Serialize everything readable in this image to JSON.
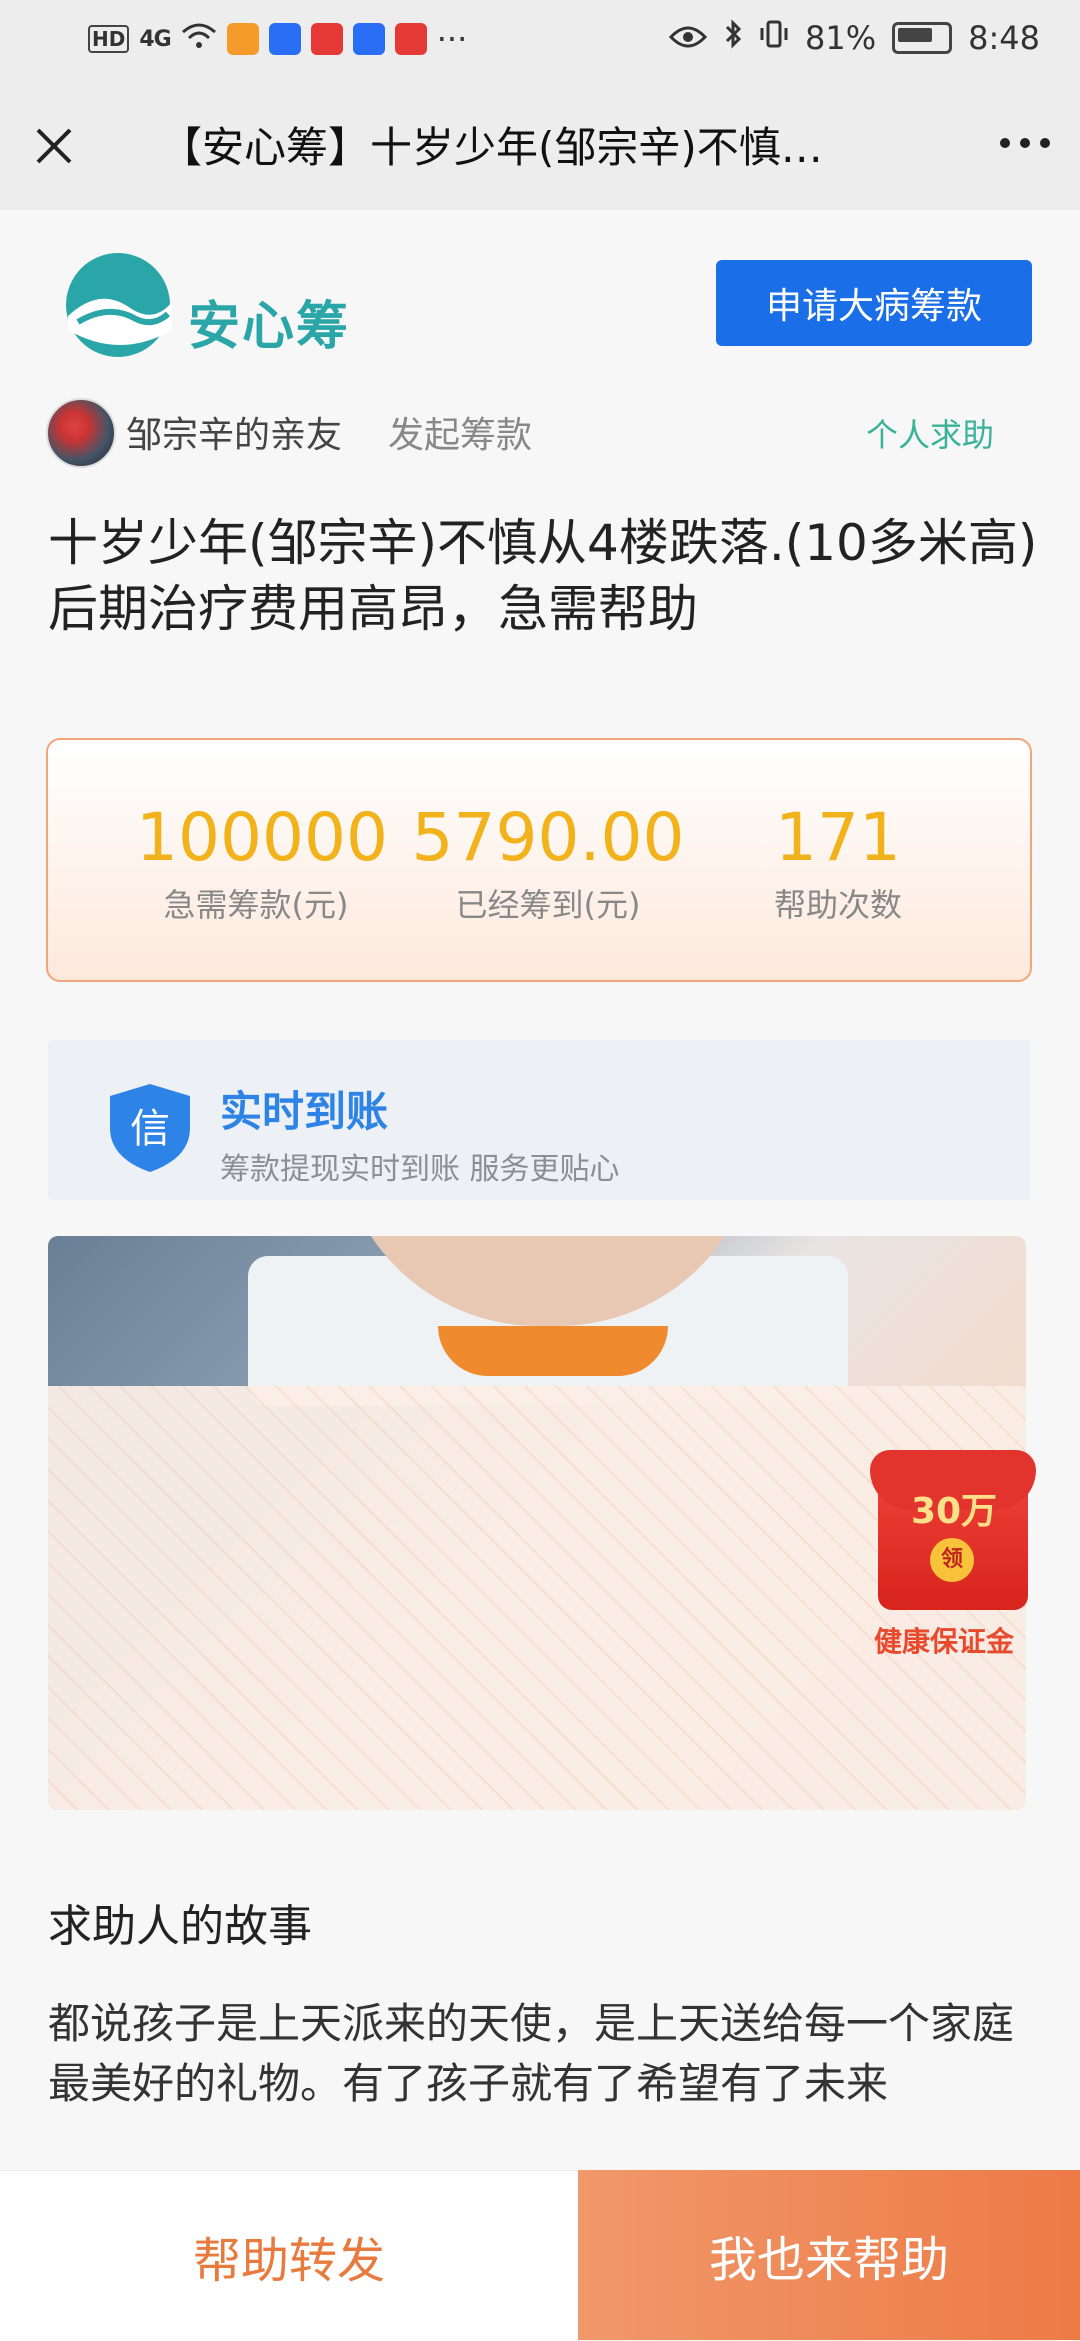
{
  "status_bar": {
    "network": "4G",
    "battery": "81%",
    "time": "8:48",
    "more": "···"
  },
  "nav": {
    "title": "【安心筹】十岁少年(邹宗辛)不慎…"
  },
  "brand": {
    "name": "安心筹",
    "apply_button": "申请大病筹款"
  },
  "organizer": {
    "name": "邹宗辛的亲友",
    "action": "发起筹款",
    "type": "个人求助"
  },
  "headline": "十岁少年(邹宗辛)不慎从4楼跌落.(10多米高)后期治疗费用高昂，急需帮助",
  "stats": [
    {
      "value": "100000",
      "label": "急需筹款(元)"
    },
    {
      "value": "5790.00",
      "label": "已经筹到(元)"
    },
    {
      "value": "171",
      "label": "帮助次数"
    }
  ],
  "realtime": {
    "icon_text": "信",
    "title": "实时到账",
    "subtitle": "筹款提现实时到账 服务更贴心"
  },
  "promo": {
    "amount": "30万",
    "coin": "领",
    "label": "健康保证金"
  },
  "story": {
    "title": "求助人的故事",
    "body": "都说孩子是上天派来的天使，是上天送给每一个家庭最美好的礼物。有了孩子就有了希望有了未来"
  },
  "bottom": {
    "share": "帮助转发",
    "help": "我也来帮助"
  },
  "colors": {
    "accent_blue": "#1a6ee8",
    "stat_yellow": "#f2b21c",
    "orange": "#ee7a46"
  }
}
